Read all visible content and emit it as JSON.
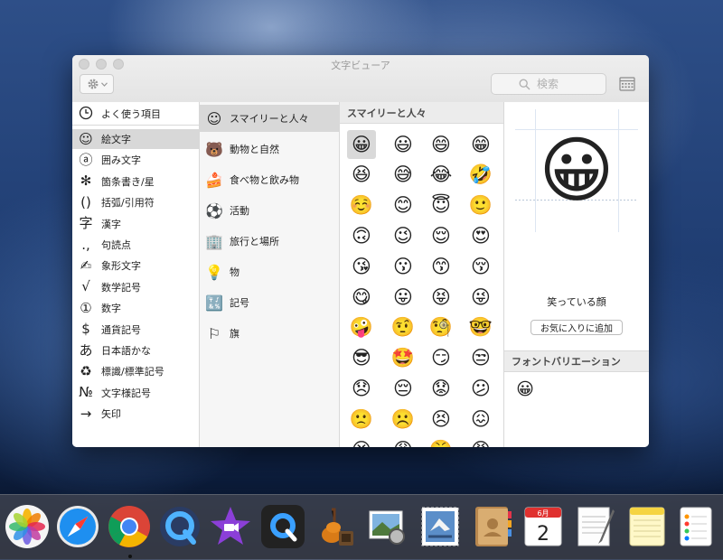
{
  "window": {
    "title": "文字ビューア",
    "search_placeholder": "検索"
  },
  "sidebar": {
    "top_item": {
      "icon": "clock-icon",
      "label": "よく使う項目"
    },
    "items": [
      {
        "icon": "smiley-icon",
        "glyph": "☺",
        "label": "絵文字",
        "selected": true
      },
      {
        "icon": "enclosed-a-icon",
        "glyph": "ⓐ",
        "label": "囲み文字"
      },
      {
        "icon": "asterisk-icon",
        "glyph": "✻",
        "label": "箇条書き/星"
      },
      {
        "icon": "parentheses-icon",
        "glyph": "()",
        "label": "括弧/引用符"
      },
      {
        "icon": "kanji-icon",
        "glyph": "字",
        "label": "漢字"
      },
      {
        "icon": "punctuation-icon",
        "glyph": ".,",
        "label": "句読点"
      },
      {
        "icon": "pictograph-icon",
        "glyph": "✍",
        "label": "象形文字"
      },
      {
        "icon": "sqrt-icon",
        "glyph": "√",
        "label": "数学記号"
      },
      {
        "icon": "circled-one-icon",
        "glyph": "①",
        "label": "数字"
      },
      {
        "icon": "dollar-icon",
        "glyph": "$",
        "label": "通貨記号"
      },
      {
        "icon": "hiragana-a-icon",
        "glyph": "あ",
        "label": "日本語かな"
      },
      {
        "icon": "recycle-icon",
        "glyph": "♻",
        "label": "標識/標準記号"
      },
      {
        "icon": "numero-icon",
        "glyph": "№",
        "label": "文字様記号"
      },
      {
        "icon": "arrow-icon",
        "glyph": "→",
        "label": "矢印"
      }
    ]
  },
  "categories": [
    {
      "icon": "smiley-face-icon",
      "glyph": "☺",
      "label": "スマイリーと人々",
      "selected": true
    },
    {
      "icon": "bear-icon",
      "glyph": "🐻",
      "label": "動物と自然"
    },
    {
      "icon": "cake-icon",
      "glyph": "🍰",
      "label": "食べ物と飲み物"
    },
    {
      "icon": "soccer-ball-icon",
      "glyph": "⚽",
      "label": "活動"
    },
    {
      "icon": "building-icon",
      "glyph": "🏢",
      "label": "旅行と場所"
    },
    {
      "icon": "lightbulb-icon",
      "glyph": "💡",
      "label": "物"
    },
    {
      "icon": "symbols-icon",
      "glyph": "🔣",
      "label": "記号"
    },
    {
      "icon": "flag-icon",
      "glyph": "⚐",
      "label": "旗"
    }
  ],
  "emoji_panel": {
    "header": "スマイリーと人々",
    "emojis": [
      "😀",
      "😃",
      "😄",
      "😁",
      "😆",
      "😅",
      "😂",
      "🤣",
      "☺️",
      "😊",
      "😇",
      "🙂",
      "🙃",
      "😉",
      "😌",
      "😍",
      "😘",
      "😗",
      "😙",
      "😚",
      "😋",
      "😛",
      "😝",
      "😜",
      "🤪",
      "🤨",
      "🧐",
      "🤓",
      "😎",
      "🤩",
      "😏",
      "😒",
      "😞",
      "😔",
      "😟",
      "😕",
      "🙁",
      "☹️",
      "😣",
      "😖",
      "😫",
      "😩",
      "😤",
      "😠"
    ]
  },
  "detail": {
    "emoji": "😀",
    "name": "笑っている顔",
    "favorite_button": "お気に入りに追加",
    "variations_header": "フォントバリエーション",
    "variations": [
      "😀"
    ]
  },
  "dock": {
    "apps": [
      "photos-icon",
      "safari-icon",
      "chrome-icon",
      "quicktime-icon",
      "imovie-icon",
      "quicktime-dark-icon",
      "garageband-icon",
      "preview-icon",
      "mail-stamp-icon",
      "contacts-icon",
      "calendar-icon",
      "textedit-icon",
      "notes-icon",
      "reminders-icon"
    ],
    "calendar_month": "6月",
    "calendar_day": "2"
  }
}
